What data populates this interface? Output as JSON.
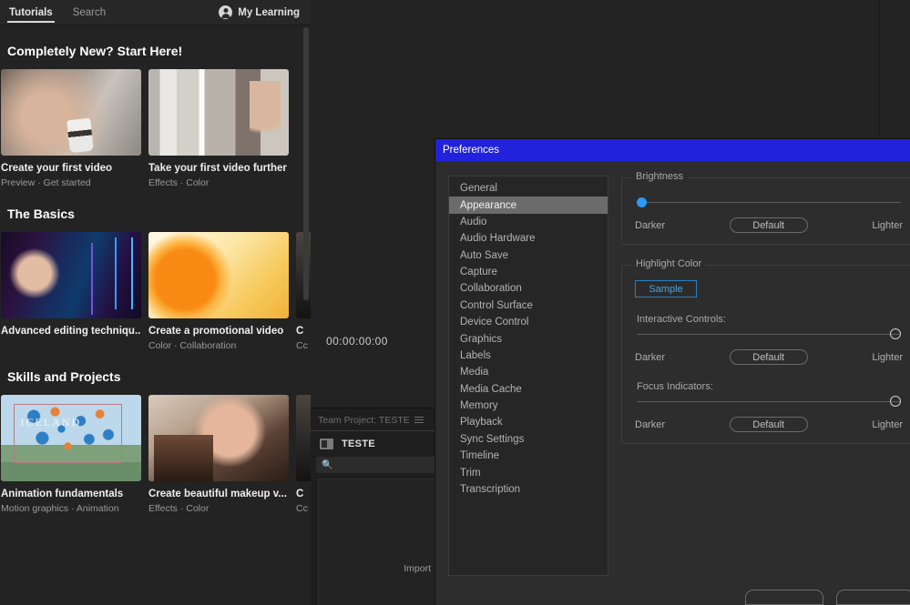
{
  "tutorials": {
    "tabs": [
      {
        "label": "Tutorials",
        "active": true
      },
      {
        "label": "Search",
        "active": false
      }
    ],
    "my_learning_label": "My Learning",
    "avatar_icon": "user-avatar-icon",
    "sections": [
      {
        "title": "Completely New? Start Here!",
        "cards": [
          {
            "title": "Create your first video",
            "subtitle": "Preview  ·  Get started",
            "art": "th-coffee"
          },
          {
            "title": "Take your first video further",
            "subtitle": "Effects  ·  Color",
            "art": "th-barber"
          }
        ],
        "partial_card": null
      },
      {
        "title": "The Basics",
        "cards": [
          {
            "title": "Advanced editing techniqu...",
            "subtitle": "",
            "art": "th-studio"
          },
          {
            "title": "Create a promotional video",
            "subtitle": "Color  ·  Collaboration",
            "art": "th-orange"
          }
        ],
        "partial_card": {
          "title": "C",
          "subtitle": "Cc",
          "art": "th-dark"
        }
      },
      {
        "title": "Skills and Projects",
        "cards": [
          {
            "title": "Animation fundamentals",
            "subtitle": "Motion graphics  ·  Animation",
            "art": "th-iceland"
          },
          {
            "title": "Create beautiful makeup v...",
            "subtitle": "Effects  ·  Color",
            "art": "th-portrait"
          }
        ],
        "partial_card": {
          "title": "C",
          "subtitle": "Cc",
          "art": "th-dark"
        }
      }
    ],
    "iceland_overlay_text": "ICELAND"
  },
  "program_monitor": {
    "timecode": "00:00:00:00"
  },
  "project_panel": {
    "header": "Team Project: TESTE",
    "menu_icon": "hamburger-menu-icon",
    "bin_icon": "project-bin-icon",
    "project_name": "TESTE",
    "search_icon": "search-icon",
    "search_placeholder": "",
    "import_text": "Import"
  },
  "preferences": {
    "title": "Preferences",
    "title_bar_color": "#2222dd",
    "categories": [
      {
        "label": "General",
        "selected": false
      },
      {
        "label": "Appearance",
        "selected": true
      },
      {
        "label": "Audio",
        "selected": false
      },
      {
        "label": "Audio Hardware",
        "selected": false
      },
      {
        "label": "Auto Save",
        "selected": false
      },
      {
        "label": "Capture",
        "selected": false
      },
      {
        "label": "Collaboration",
        "selected": false
      },
      {
        "label": "Control Surface",
        "selected": false
      },
      {
        "label": "Device Control",
        "selected": false
      },
      {
        "label": "Graphics",
        "selected": false
      },
      {
        "label": "Labels",
        "selected": false
      },
      {
        "label": "Media",
        "selected": false
      },
      {
        "label": "Media Cache",
        "selected": false
      },
      {
        "label": "Memory",
        "selected": false
      },
      {
        "label": "Playback",
        "selected": false
      },
      {
        "label": "Sync Settings",
        "selected": false
      },
      {
        "label": "Timeline",
        "selected": false
      },
      {
        "label": "Trim",
        "selected": false
      },
      {
        "label": "Transcription",
        "selected": false
      }
    ],
    "brightness": {
      "legend": "Brightness",
      "darker_label": "Darker",
      "default_label": "Default",
      "lighter_label": "Lighter",
      "knob_position": "left",
      "accent_color": "#2b9af3"
    },
    "highlight_color": {
      "legend": "Highlight Color",
      "sample_label": "Sample",
      "sample_color": "#4aa3e0",
      "interactive_controls": {
        "label": "Interactive Controls:",
        "darker_label": "Darker",
        "default_label": "Default",
        "lighter_label": "Lighter",
        "knob_position": "right"
      },
      "focus_indicators": {
        "label": "Focus Indicators:",
        "darker_label": "Darker",
        "default_label": "Default",
        "lighter_label": "Lighter",
        "knob_position": "right"
      }
    }
  }
}
